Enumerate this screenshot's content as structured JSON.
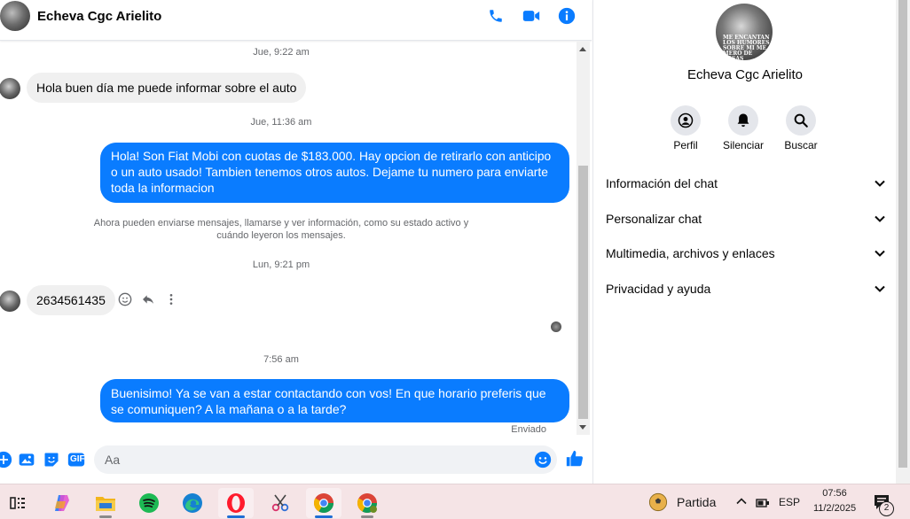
{
  "chat": {
    "contact_name": "Echeva Cgc Arielito",
    "messages": [
      {
        "type": "time",
        "text": "Jue, 9:22 am"
      },
      {
        "type": "incoming",
        "text": "Hola buen día me puede informar sobre el auto"
      },
      {
        "type": "time",
        "text": "Jue, 11:36 am"
      },
      {
        "type": "outgoing",
        "text": "Hola! Son Fiat Mobi con cuotas de $183.000. Hay opcion de retirarlo con anticipo o un auto usado! Tambien tenemos otros autos. Dejame tu numero para enviarte toda la informacion"
      },
      {
        "type": "notice",
        "text": "Ahora pueden enviarse mensajes, llamarse y ver información, como su estado activo y cuándo leyeron los mensajes."
      },
      {
        "type": "time",
        "text": "Lun, 9:21 pm"
      },
      {
        "type": "incoming",
        "text": "2634561435"
      },
      {
        "type": "time",
        "text": "7:56 am"
      },
      {
        "type": "outgoing",
        "text": "Buenisimo! Ya se van a estar contactando con vos! En que horario preferis que se comuniquen? A la mañana o a la tarde?"
      }
    ],
    "sent_status": "Enviado",
    "composer_placeholder": "Aa",
    "gif_label": "GIF"
  },
  "info_panel": {
    "name": "Echeva Cgc Arielito",
    "avatar_caption": "ME ENCANTAN LOS HUMORES SOBRE MI ME MERO DE COSAS",
    "actions": [
      {
        "label": "Perfil",
        "icon": "profile-icon"
      },
      {
        "label": "Silenciar",
        "icon": "bell-icon"
      },
      {
        "label": "Buscar",
        "icon": "search-icon"
      }
    ],
    "sections": [
      {
        "label": "Información del chat"
      },
      {
        "label": "Personalizar chat"
      },
      {
        "label": "Multimedia, archivos y enlaces"
      },
      {
        "label": "Privacidad y ayuda"
      }
    ]
  },
  "taskbar": {
    "weather_label": "Partida",
    "language": "ESP",
    "time": "07:56",
    "date": "11/2/2025",
    "notification_count": "2"
  },
  "colors": {
    "accent": "#0a7cff",
    "incoming_bubble": "#f0f0f0",
    "taskbar": "#f5e4e6"
  }
}
